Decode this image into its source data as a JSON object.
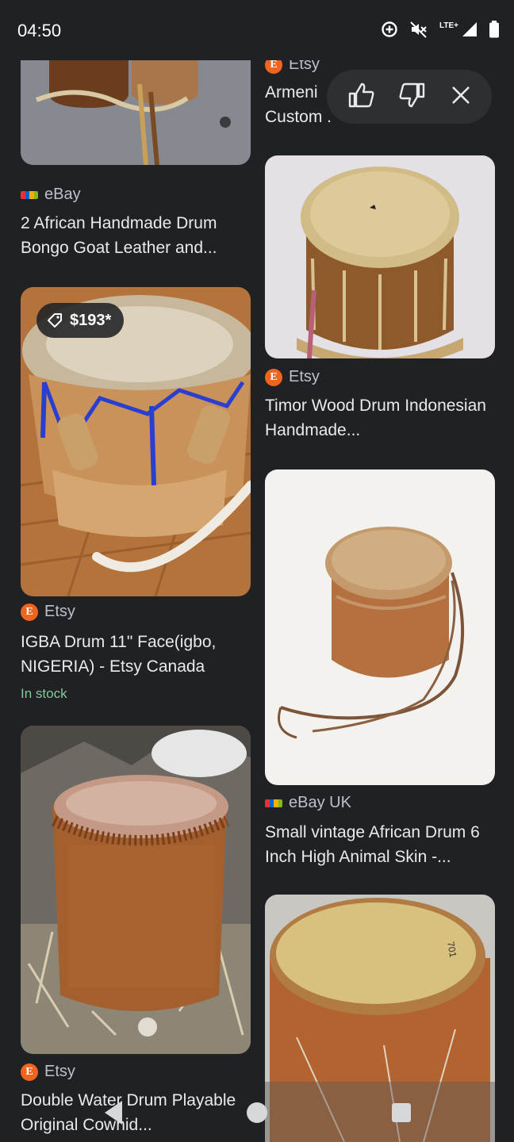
{
  "status_bar": {
    "time": "04:50",
    "network_label": "LTE+",
    "icons": [
      "data-saver-icon",
      "mute-icon",
      "signal-icon",
      "battery-icon"
    ]
  },
  "feedback": {
    "icons": [
      "thumbs-up-icon",
      "thumbs-down-icon",
      "close-icon"
    ]
  },
  "left_column": {
    "card1": {
      "source": "eBay",
      "title": "2 African Handmade Drum Bongo Goat Leather and..."
    },
    "card2": {
      "price": "$193*",
      "source": "Etsy",
      "title": "IGBA Drum 11\" Face(igbo, NIGERIA) - Etsy Canada",
      "stock": "In stock"
    },
    "card3": {
      "source": "Etsy",
      "title": "Double Water Drum Playable Original Cowhid..."
    }
  },
  "right_column": {
    "card0": {
      "source": "Etsy",
      "title": "Armeni Custom ."
    },
    "card1": {
      "source": "Etsy",
      "title": "Timor Wood Drum Indonesian Handmade..."
    },
    "card2": {
      "source": "eBay UK",
      "title": "Small vintage African Drum 6 Inch High Animal Skin -..."
    }
  },
  "colors": {
    "background": "#202124",
    "text": "#e8eaed",
    "source_text": "#bdc1c6",
    "stock_green": "#81c995",
    "etsy_orange": "#f1641e"
  }
}
